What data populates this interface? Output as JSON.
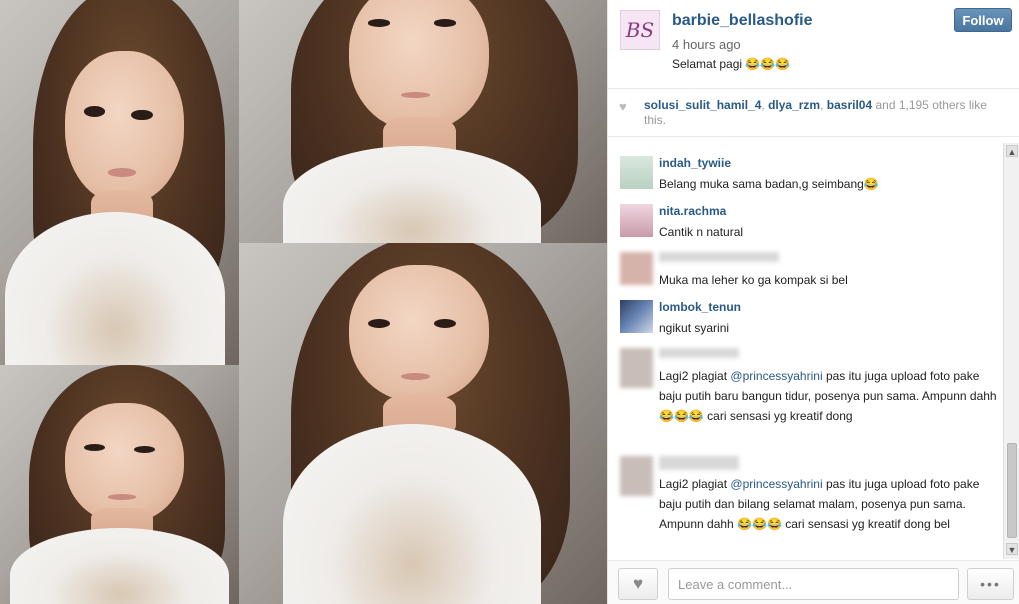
{
  "post": {
    "avatar_glyph": "BS",
    "username": "barbie_bellashofie",
    "time": "4 hours ago",
    "caption": "Selamat pagi 😂😂😂",
    "follow_label": "Follow"
  },
  "likes": {
    "heart_icon": "heart-icon",
    "user1": "solusi_sulit_hamil_4",
    "sep1": ", ",
    "user2": "dlya_rzm",
    "sep2": ", ",
    "user3": "basril04",
    "rest": " and 1,195 others like this."
  },
  "comments": [
    {
      "username": "indah_tywiie",
      "text": "Belang muka sama badan,g seimbang😂"
    },
    {
      "username": "nita.rachma",
      "text": "Cantik n natural"
    },
    {
      "username": "",
      "text": "Muka ma leher ko ga kompak si bel"
    },
    {
      "username": "lombok_tenun",
      "text": "ngikut syarini"
    },
    {
      "username": "",
      "text_before": "Lagi2 plagiat ",
      "mention": "@princessyahrini",
      "text_after": " pas itu juga upload foto pake baju putih baru bangun tidur, posenya pun sama. Ampunn dahh 😂😂😂 cari sensasi yg kreatif dong"
    },
    {
      "username": "",
      "text_before": "Lagi2 plagiat ",
      "mention": "@princessyahrini",
      "text_after": " pas itu juga upload foto pake baju putih dan bilang selamat malam, posenya pun sama. Ampunn dahh 😂😂😂 cari sensasi yg kreatif dong bel"
    }
  ],
  "footer": {
    "comment_placeholder": "Leave a comment...",
    "more_label": "•••"
  },
  "colors": {
    "link": "#2a5a86",
    "follow_button": "#4a76a0"
  }
}
